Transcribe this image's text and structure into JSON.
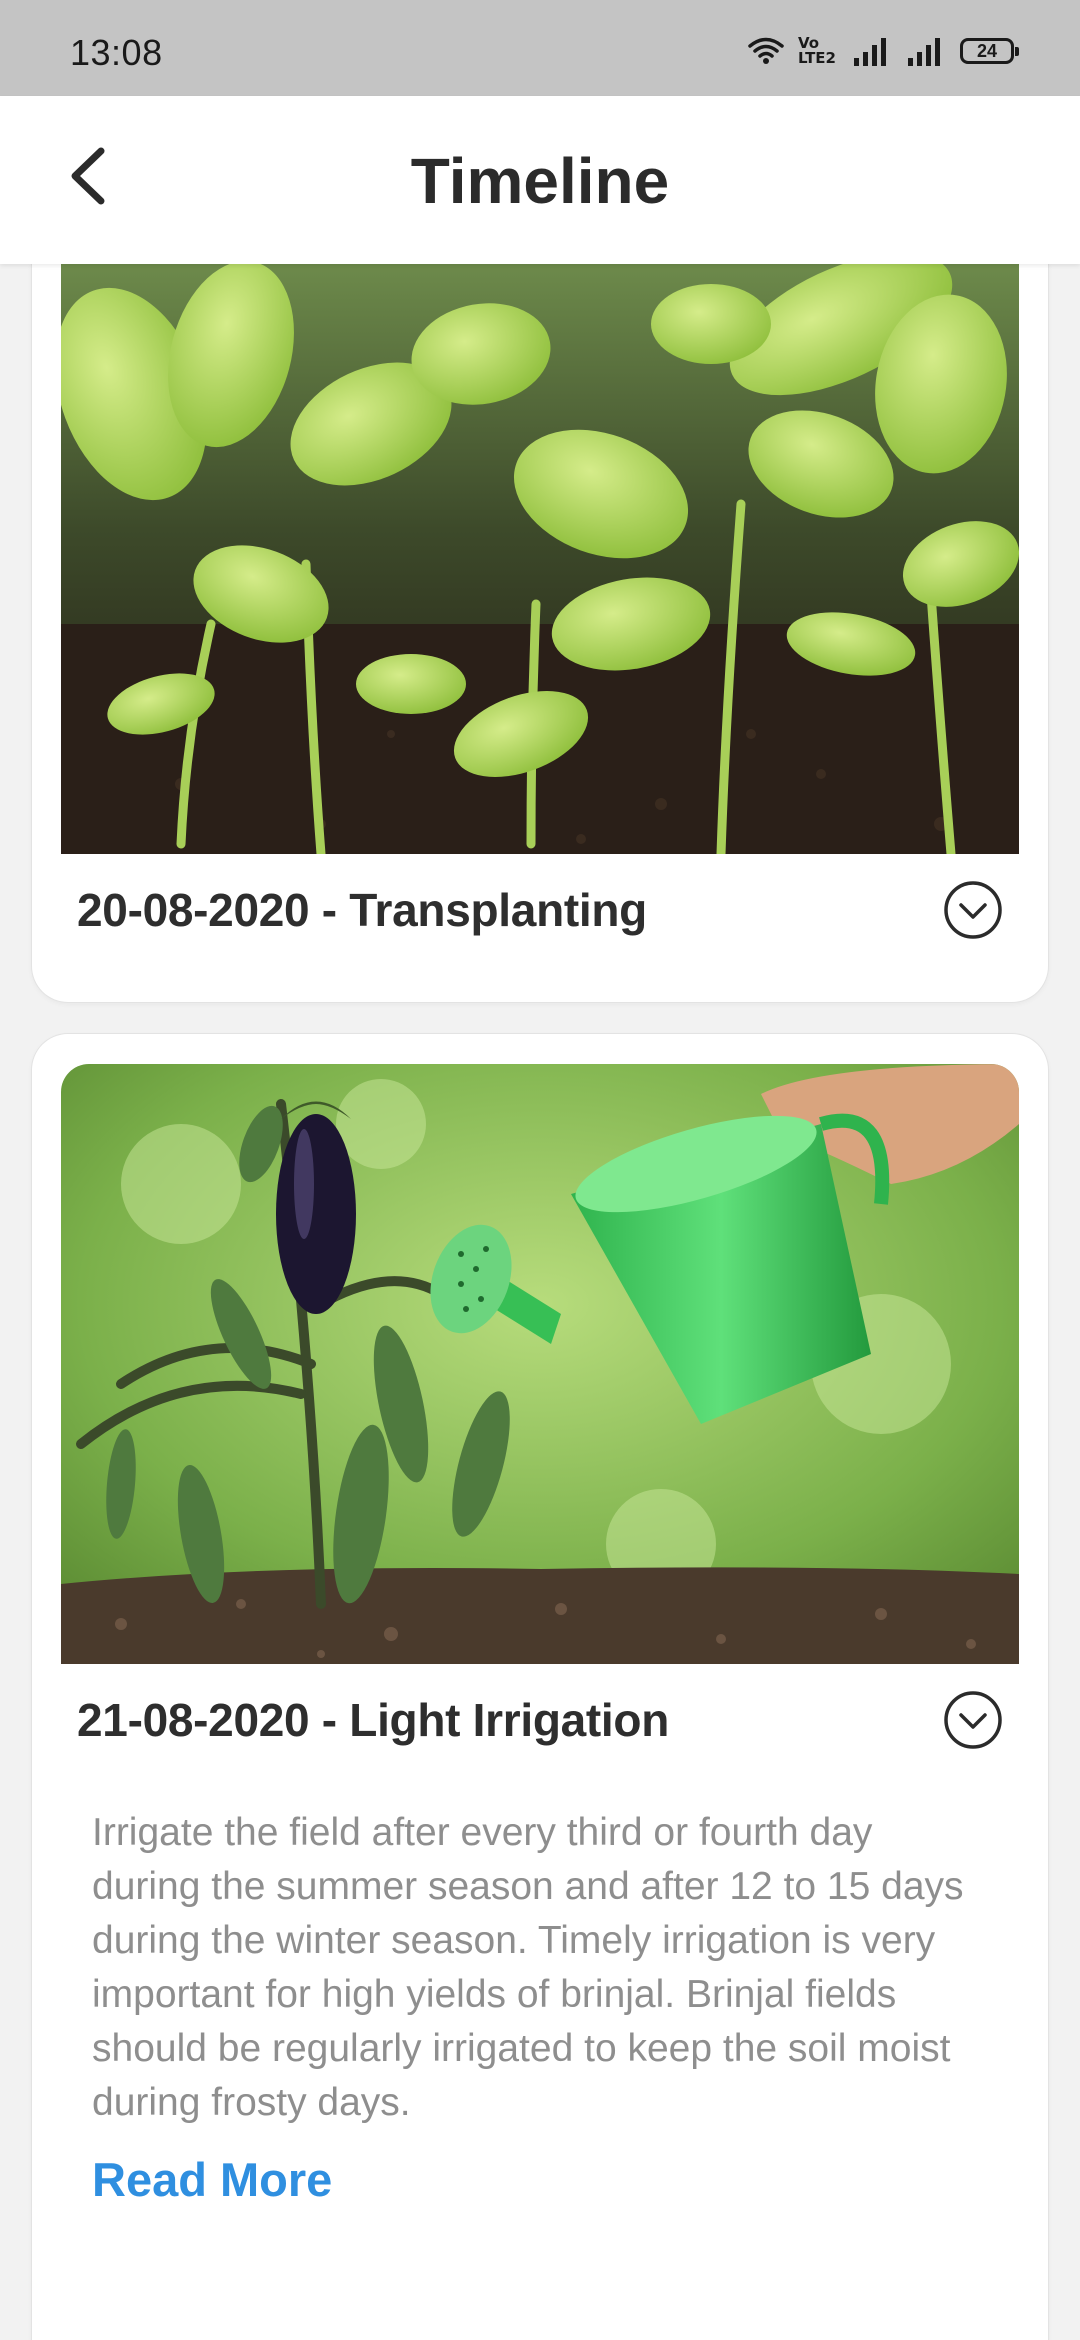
{
  "status_bar": {
    "time": "13:08",
    "network_label": "Vo LTE2",
    "battery": "24",
    "icons": [
      "wifi-icon",
      "volte-icon",
      "signal-icon",
      "signal-icon",
      "battery-icon"
    ]
  },
  "app_bar": {
    "title": "Timeline",
    "back_icon": "chevron-left-icon"
  },
  "timeline": [
    {
      "date": "20-08-2020",
      "activity": "Transplanting",
      "title": "20-08-2020 - Transplanting",
      "image": "eggplant-seedlings-in-soil",
      "expanded": false,
      "toggle_icon": "chevron-down-circle-icon"
    },
    {
      "date": "21-08-2020",
      "activity": "Light Irrigation",
      "title": "21-08-2020 - Light Irrigation",
      "image": "watering-can-over-brinjal-plant",
      "expanded": true,
      "toggle_icon": "chevron-down-circle-icon",
      "description": "Irrigate the field after every third or fourth day during the summer season and after 12 to 15 days during the winter season. Timely irrigation is very important for high yields of brinjal. Brinjal fields should be regularly irrigated to keep the soil moist during frosty days.",
      "read_more_label": "Read More"
    }
  ],
  "colors": {
    "status_bar_bg": "#c4c4c4",
    "page_bg": "#f2f2f2",
    "card_bg": "#ffffff",
    "title_text": "#2e2e2e",
    "description_text": "#8e8e8e",
    "link": "#2f8fe0"
  }
}
